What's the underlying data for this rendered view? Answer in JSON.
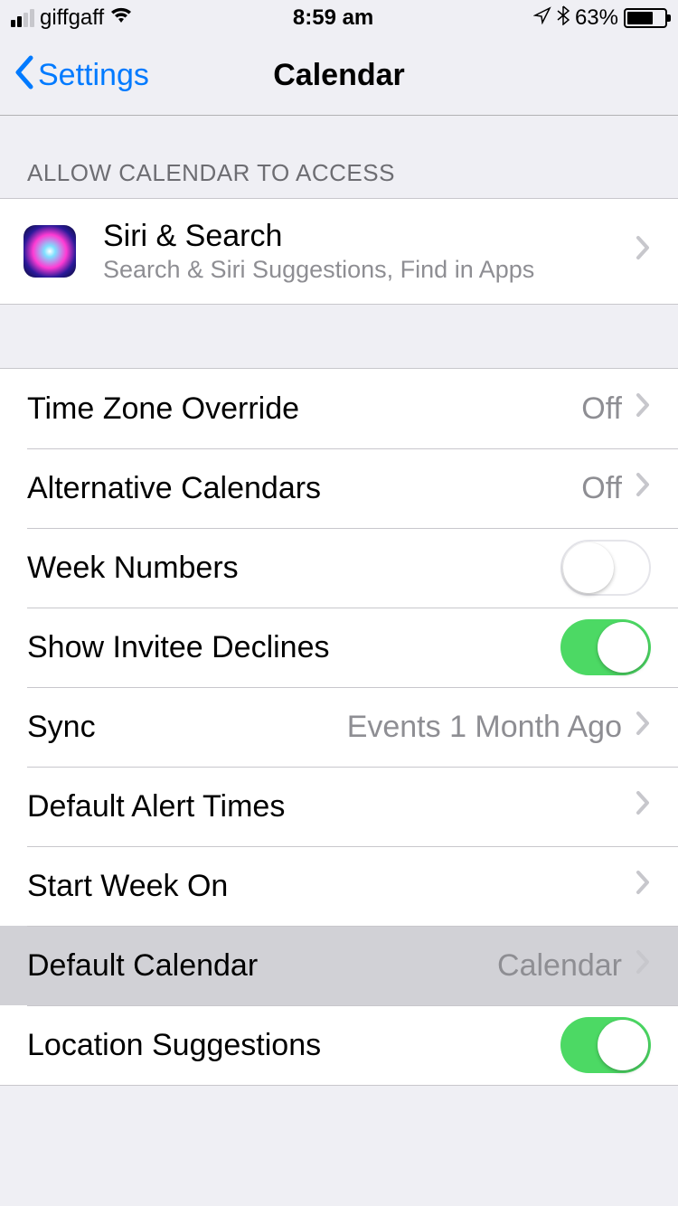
{
  "statusBar": {
    "carrier": "giffgaff",
    "time": "8:59 am",
    "batteryPct": "63%"
  },
  "nav": {
    "back": "Settings",
    "title": "Calendar"
  },
  "sections": {
    "accessHeader": "ALLOW CALENDAR TO ACCESS",
    "siri": {
      "title": "Siri & Search",
      "subtitle": "Search & Siri Suggestions, Find in Apps"
    },
    "rows": {
      "timeZoneOverride": {
        "label": "Time Zone Override",
        "value": "Off"
      },
      "alternativeCalendars": {
        "label": "Alternative Calendars",
        "value": "Off"
      },
      "weekNumbers": {
        "label": "Week Numbers",
        "on": false
      },
      "showInviteeDeclines": {
        "label": "Show Invitee Declines",
        "on": true
      },
      "sync": {
        "label": "Sync",
        "value": "Events 1 Month Ago"
      },
      "defaultAlertTimes": {
        "label": "Default Alert Times"
      },
      "startWeekOn": {
        "label": "Start Week On"
      },
      "defaultCalendar": {
        "label": "Default Calendar",
        "value": "Calendar"
      },
      "locationSuggestions": {
        "label": "Location Suggestions",
        "on": true
      }
    }
  }
}
